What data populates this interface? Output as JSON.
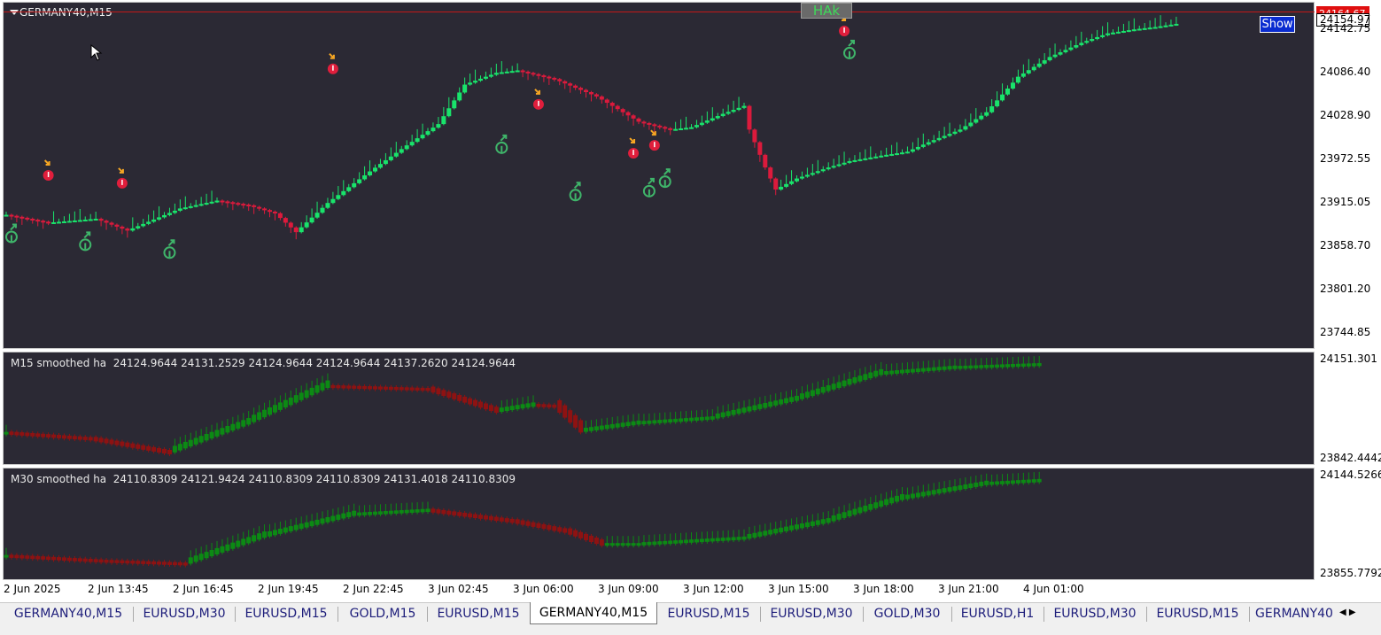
{
  "window": {
    "symbol_timeframe": "GERMANY40,M15"
  },
  "buttons": {
    "hak": "HAk",
    "show": "Show"
  },
  "price": {
    "bid_label": "24164.67",
    "last_label": "24154.97"
  },
  "main_axis": {
    "ticks": [
      "24142.75",
      "24086.40",
      "24028.90",
      "23972.55",
      "23915.05",
      "23858.70",
      "23801.20",
      "23744.85"
    ]
  },
  "sub1": {
    "label": "M15 smoothed ha  24124.9644 24131.2529 24124.9644 24124.9644 24137.2620 24124.9644",
    "axis_top": "24151.301",
    "axis_bottom": "23842.4442"
  },
  "sub2": {
    "label": "M30 smoothed ha  24110.8309 24121.9424 24110.8309 24110.8309 24131.4018 24110.8309",
    "axis_top": "24144.5266",
    "axis_bottom": "23855.7792"
  },
  "time_axis": [
    "2 Jun 2025",
    "2 Jun 13:45",
    "2 Jun 16:45",
    "2 Jun 19:45",
    "2 Jun 22:45",
    "3 Jun 02:45",
    "3 Jun 06:00",
    "3 Jun 09:00",
    "3 Jun 12:00",
    "3 Jun 15:00",
    "3 Jun 18:00",
    "3 Jun 21:00",
    "4 Jun 01:00"
  ],
  "tabs": [
    {
      "label": "GERMANY40,M15",
      "active": false
    },
    {
      "label": "EURUSD,M30",
      "active": false
    },
    {
      "label": "EURUSD,M15",
      "active": false
    },
    {
      "label": "GOLD,M15",
      "active": false
    },
    {
      "label": "EURUSD,M15",
      "active": false
    },
    {
      "label": "GERMANY40,M15",
      "active": true
    },
    {
      "label": "EURUSD,M15",
      "active": false
    },
    {
      "label": "EURUSD,M30",
      "active": false
    },
    {
      "label": "GOLD,M30",
      "active": false
    },
    {
      "label": "EURUSD,H1",
      "active": false
    },
    {
      "label": "EURUSD,M30",
      "active": false
    },
    {
      "label": "EURUSD,M15",
      "active": false
    },
    {
      "label": "GERMANY40",
      "active": false
    }
  ],
  "colors": {
    "bull": "#19e36b",
    "bear": "#dc1a3c",
    "sub_bull": "#0c8a14",
    "sub_bear": "#8e1212",
    "signal_up": "#3fb56a",
    "signal_down": "#e01e3c",
    "signal_arrow_down": "#f5a623"
  },
  "chart_data": {
    "type": "candlestick",
    "y_range": [
      23720,
      24160
    ],
    "anchors": [
      [
        0,
        23890
      ],
      [
        8,
        23880
      ],
      [
        17,
        23885
      ],
      [
        23,
        23870
      ],
      [
        33,
        23898
      ],
      [
        40,
        23908
      ],
      [
        46,
        23902
      ],
      [
        51,
        23892
      ],
      [
        55,
        23868
      ],
      [
        61,
        23905
      ],
      [
        69,
        23945
      ],
      [
        76,
        23978
      ],
      [
        82,
        24005
      ],
      [
        87,
        24055
      ],
      [
        93,
        24070
      ],
      [
        97,
        24073
      ],
      [
        104,
        24062
      ],
      [
        112,
        24040
      ],
      [
        120,
        24008
      ],
      [
        126,
        23998
      ],
      [
        130,
        24001
      ],
      [
        136,
        24018
      ],
      [
        140,
        24028
      ],
      [
        141,
        23998
      ],
      [
        144,
        23950
      ],
      [
        146,
        23922
      ],
      [
        150,
        23936
      ],
      [
        156,
        23950
      ],
      [
        160,
        23958
      ],
      [
        166,
        23965
      ],
      [
        171,
        23970
      ],
      [
        175,
        23982
      ],
      [
        181,
        23998
      ],
      [
        186,
        24020
      ],
      [
        192,
        24065
      ],
      [
        198,
        24090
      ],
      [
        204,
        24108
      ],
      [
        209,
        24120
      ],
      [
        214,
        24125
      ],
      [
        218,
        24128
      ],
      [
        222,
        24132
      ]
    ],
    "signals_up": [
      [
        1,
        23862
      ],
      [
        15,
        23852
      ],
      [
        31,
        23842
      ],
      [
        94,
        23975
      ],
      [
        108,
        23915
      ],
      [
        122,
        23920
      ],
      [
        125,
        23932
      ],
      [
        160,
        24095
      ]
    ],
    "signals_down": [
      [
        8,
        23940
      ],
      [
        22,
        23930
      ],
      [
        62,
        24075
      ],
      [
        101,
        24030
      ],
      [
        119,
        23968
      ],
      [
        123,
        23978
      ],
      [
        159,
        24123
      ]
    ],
    "sub1_anchors": [
      [
        0,
        0.28
      ],
      [
        16,
        0.22
      ],
      [
        31,
        0.08
      ],
      [
        46,
        0.38
      ],
      [
        61,
        0.75
      ],
      [
        80,
        0.72
      ],
      [
        93,
        0.5
      ],
      [
        100,
        0.56
      ],
      [
        104,
        0.55
      ],
      [
        109,
        0.3
      ],
      [
        120,
        0.38
      ],
      [
        134,
        0.43
      ],
      [
        150,
        0.62
      ],
      [
        166,
        0.88
      ],
      [
        180,
        0.94
      ],
      [
        196,
        0.97
      ]
    ],
    "sub2_anchors": [
      [
        0,
        0.2
      ],
      [
        18,
        0.15
      ],
      [
        34,
        0.12
      ],
      [
        49,
        0.4
      ],
      [
        66,
        0.62
      ],
      [
        80,
        0.66
      ],
      [
        96,
        0.55
      ],
      [
        106,
        0.45
      ],
      [
        113,
        0.32
      ],
      [
        120,
        0.32
      ],
      [
        140,
        0.38
      ],
      [
        156,
        0.55
      ],
      [
        170,
        0.78
      ],
      [
        186,
        0.93
      ],
      [
        196,
        0.96
      ]
    ]
  }
}
